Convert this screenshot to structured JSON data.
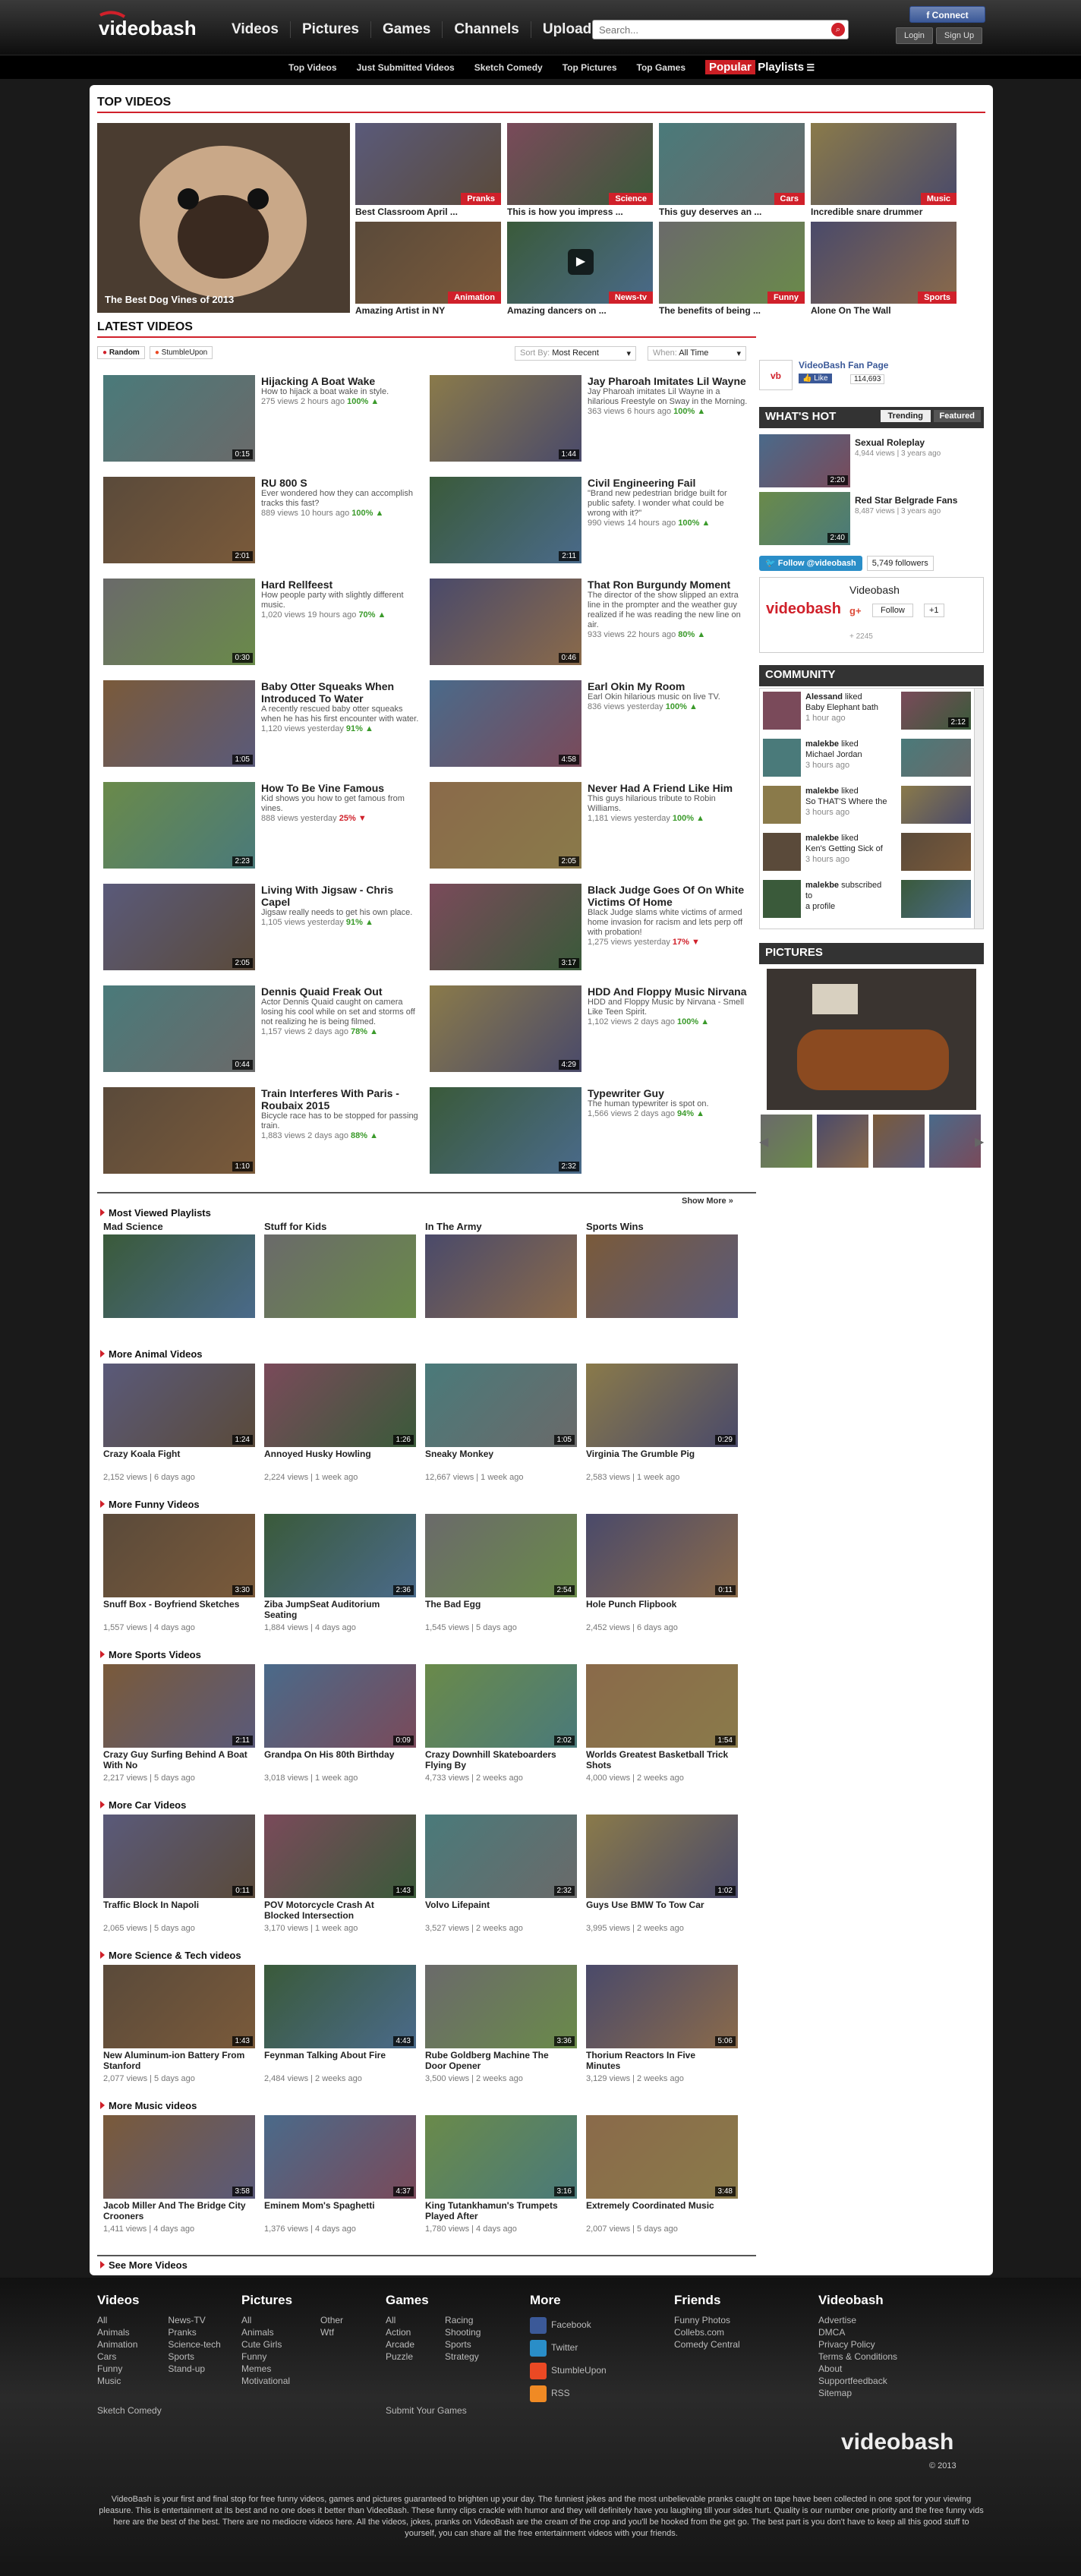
{
  "header": {
    "logo": "videobash",
    "nav": [
      "Videos",
      "Pictures",
      "Games",
      "Channels",
      "Upload"
    ],
    "search_placeholder": "Search...",
    "connect": "Connect",
    "login": "Login",
    "signup": "Sign Up"
  },
  "subnav": {
    "items": [
      "Top Videos",
      "Just Submitted Videos",
      "Sketch Comedy",
      "Top Pictures",
      "Top Games"
    ],
    "popular": "Popular",
    "playlists": "Playlists"
  },
  "top_videos": {
    "title": "TOP VIDEOS",
    "featured": "The Best Dog Vines of 2013",
    "items": [
      {
        "title": "Best Classroom April ...",
        "cat": "Pranks"
      },
      {
        "title": "This is how you impress ...",
        "cat": "Science"
      },
      {
        "title": "This guy deserves an ...",
        "cat": "Cars"
      },
      {
        "title": "Incredible snare drummer",
        "cat": "Music"
      },
      {
        "title": "Amazing Artist in NY",
        "cat": "Animation"
      },
      {
        "title": "Amazing dancers on ...",
        "cat": "News-tv"
      },
      {
        "title": "The benefits of being ...",
        "cat": "Funny"
      },
      {
        "title": "Alone On The Wall",
        "cat": "Sports"
      }
    ]
  },
  "latest": {
    "title": "LATEST VIDEOS",
    "random": "Random",
    "stumble": "StumbleUpon",
    "sort_label": "Sort By:",
    "sort_value": "Most Recent",
    "when_label": "When:",
    "when_value": "All Time",
    "show_more": "Show More »",
    "videos": [
      {
        "title": "Hijacking A Boat Wake",
        "desc": "How to hijack a boat wake in style.",
        "views": "275 views",
        "age": "2 hours ago",
        "pct": "100%",
        "dur": "0:15"
      },
      {
        "title": "Jay Pharoah Imitates Lil Wayne",
        "desc": "Jay Pharoah imitates Lil Wayne in a hilarious Freestyle on Sway in the Morning.",
        "views": "363 views",
        "age": "6 hours ago",
        "pct": "100%",
        "dur": "1:44"
      },
      {
        "title": "RU 800 S",
        "desc": "Ever wondered how they can accomplish tracks this fast?",
        "views": "889 views",
        "age": "10 hours ago",
        "pct": "100%",
        "dur": "2:01"
      },
      {
        "title": "Civil Engineering Fail",
        "desc": "\"Brand new pedestrian bridge built for public safety. I wonder what could be wrong with it?\"",
        "views": "990 views",
        "age": "14 hours ago",
        "pct": "100%",
        "dur": "2:11"
      },
      {
        "title": "Hard Rellfeest",
        "desc": "How people party with slightly different music.",
        "views": "1,020 views",
        "age": "19 hours ago",
        "pct": "70%",
        "dur": "0:30"
      },
      {
        "title": "That Ron Burgundy Moment",
        "desc": "The director of the show slipped an extra line in the prompter and the weather guy realized if he was reading the new line on air.",
        "views": "933 views",
        "age": "22 hours ago",
        "pct": "80%",
        "dur": "0:46"
      },
      {
        "title": "Baby Otter Squeaks When Introduced To Water",
        "desc": "A recently rescued baby otter squeaks when he has his first encounter with water.",
        "views": "1,120 views",
        "age": "yesterday",
        "pct": "91%",
        "dur": "1:05"
      },
      {
        "title": "Earl Okin My Room",
        "desc": "Earl Okin hilarious music on live TV.",
        "views": "836 views",
        "age": "yesterday",
        "pct": "100%",
        "dur": "4:58"
      },
      {
        "title": "How To Be Vine Famous",
        "desc": "Kid shows you how to get famous from vines.",
        "views": "888 views",
        "age": "yesterday",
        "pct": "25%",
        "neg": true,
        "dur": "2:23"
      },
      {
        "title": "Never Had A Friend Like Him",
        "desc": "This guys hilarious tribute to Robin Williams.",
        "views": "1,181 views",
        "age": "yesterday",
        "pct": "100%",
        "dur": "2:05"
      },
      {
        "title": "Living With Jigsaw - Chris Capel",
        "desc": "Jigsaw really needs to get his own place.",
        "views": "1,105 views",
        "age": "yesterday",
        "pct": "91%",
        "dur": "2:05"
      },
      {
        "title": "Black Judge Goes Of On White Victims Of Home",
        "desc": "Black Judge slams white victims of armed home invasion for racism and lets perp off with probation!",
        "views": "1,275 views",
        "age": "yesterday",
        "pct": "17%",
        "neg": true,
        "dur": "3:17"
      },
      {
        "title": "Dennis Quaid Freak Out",
        "desc": "Actor Dennis Quaid caught on camera losing his cool while on set and storms off not realizing he is being filmed.",
        "views": "1,157 views",
        "age": "2 days ago",
        "pct": "78%",
        "dur": "0:44"
      },
      {
        "title": "HDD And Floppy Music Nirvana",
        "desc": "HDD and Floppy Music by Nirvana - Smell Like Teen Spirit.",
        "views": "1,102 views",
        "age": "2 days ago",
        "pct": "100%",
        "dur": "4:29"
      },
      {
        "title": "Train Interferes With Paris - Roubaix 2015",
        "desc": "Bicycle race has to be stopped for passing train.",
        "views": "1,883 views",
        "age": "2 days ago",
        "pct": "88%",
        "dur": "1:10"
      },
      {
        "title": "Typewriter Guy",
        "desc": "The human typewriter is spot on.",
        "views": "1,566 views",
        "age": "2 days ago",
        "pct": "94%",
        "dur": "2:32"
      }
    ]
  },
  "playlists": {
    "title": "Most Viewed Playlists",
    "items": [
      "Mad Science",
      "Stuff for Kids",
      "In The Army",
      "Sports Wins"
    ]
  },
  "groups": [
    {
      "title": "More Animal Videos",
      "items": [
        {
          "t": "Crazy Koala Fight",
          "m": "2,152 views | 6 days ago",
          "d": "1:24"
        },
        {
          "t": "Annoyed Husky Howling",
          "m": "2,224 views | 1 week ago",
          "d": "1:26"
        },
        {
          "t": "Sneaky Monkey",
          "m": "12,667 views | 1 week ago",
          "d": "1:05"
        },
        {
          "t": "Virginia The Grumble Pig",
          "m": "2,583 views | 1 week ago",
          "d": "0:29"
        }
      ]
    },
    {
      "title": "More Funny Videos",
      "items": [
        {
          "t": "Snuff Box - Boyfriend Sketches",
          "m": "1,557 views | 4 days ago",
          "d": "3:30"
        },
        {
          "t": "Ziba JumpSeat Auditorium Seating",
          "m": "1,884 views | 4 days ago",
          "d": "2:36"
        },
        {
          "t": "The Bad Egg",
          "m": "1,545 views | 5 days ago",
          "d": "2:54"
        },
        {
          "t": "Hole Punch Flipbook",
          "m": "2,452 views | 6 days ago",
          "d": "0:11"
        }
      ]
    },
    {
      "title": "More Sports Videos",
      "items": [
        {
          "t": "Crazy Guy Surfing Behind A Boat With No",
          "m": "2,217 views | 5 days ago",
          "d": "2:11"
        },
        {
          "t": "Grandpa On His 80th Birthday",
          "m": "3,018 views | 1 week ago",
          "d": "0:09"
        },
        {
          "t": "Crazy Downhill Skateboarders Flying By",
          "m": "4,733 views | 2 weeks ago",
          "d": "2:02"
        },
        {
          "t": "Worlds Greatest Basketball Trick Shots",
          "m": "4,000 views | 2 weeks ago",
          "d": "1:54"
        }
      ]
    },
    {
      "title": "More Car Videos",
      "items": [
        {
          "t": "Traffic Block In Napoli",
          "m": "2,065 views | 5 days ago",
          "d": "0:11"
        },
        {
          "t": "POV Motorcycle Crash At Blocked Intersection",
          "m": "3,170 views | 1 week ago",
          "d": "1:43"
        },
        {
          "t": "Volvo Lifepaint",
          "m": "3,527 views | 2 weeks ago",
          "d": "2:32"
        },
        {
          "t": "Guys Use BMW To Tow Car",
          "m": "3,995 views | 2 weeks ago",
          "d": "1:02"
        }
      ]
    },
    {
      "title": "More Science & Tech videos",
      "items": [
        {
          "t": "New Aluminum-ion Battery From Stanford",
          "m": "2,077 views | 5 days ago",
          "d": "1:43"
        },
        {
          "t": "Feynman Talking About Fire",
          "m": "2,484 views | 2 weeks ago",
          "d": "4:43"
        },
        {
          "t": "Rube Goldberg Machine The Door Opener",
          "m": "3,500 views | 2 weeks ago",
          "d": "3:36"
        },
        {
          "t": "Thorium Reactors In Five Minutes",
          "m": "3,129 views | 2 weeks ago",
          "d": "5:06"
        }
      ]
    },
    {
      "title": "More Music videos",
      "items": [
        {
          "t": "Jacob Miller And The Bridge City Crooners",
          "m": "1,411 views | 4 days ago",
          "d": "3:58"
        },
        {
          "t": "Eminem Mom's Spaghetti",
          "m": "1,376 views | 4 days ago",
          "d": "4:37"
        },
        {
          "t": "King Tutankhamun's Trumpets Played After",
          "m": "1,780 views | 4 days ago",
          "d": "3:16"
        },
        {
          "t": "Extremely Coordinated Music",
          "m": "2,007 views | 5 days ago",
          "d": "3:48"
        }
      ]
    }
  ],
  "see_more": "See More Videos",
  "sidebar": {
    "fan_page": "VideoBash Fan Page",
    "like": "Like",
    "like_count": "114,693",
    "whats_hot": "WHAT'S HOT",
    "tab_trending": "Trending",
    "tab_featured": "Featured",
    "hot": [
      {
        "t": "Sexual Roleplay",
        "m": "4,944 views | 3 years ago",
        "d": "2:20"
      },
      {
        "t": "Red Star Belgrade Fans",
        "m": "8,487 views | 3 years ago",
        "d": "2:40"
      }
    ],
    "follow": "Follow @videobash",
    "followers": "5,749 followers",
    "gp_name": "Videobash",
    "gp_follow": "Follow",
    "gp_plus": "+1",
    "gp_count": "+ 2245",
    "community": "COMMUNITY",
    "comm": [
      {
        "u": "Alessand",
        "a": "liked",
        "t": "Baby Elephant bath",
        "m": "1 hour ago",
        "d": "2:12"
      },
      {
        "u": "malekbe",
        "a": "liked",
        "t": "Michael Jordan",
        "m": "3 hours ago"
      },
      {
        "u": "malekbe",
        "a": "liked",
        "t": "So THAT'S Where the",
        "m": "3 hours ago"
      },
      {
        "u": "malekbe",
        "a": "liked",
        "t": "Ken's Getting Sick of",
        "m": "3 hours ago"
      },
      {
        "u": "malekbe",
        "a": "subscribed to",
        "t": "a profile",
        "m": ""
      }
    ],
    "pictures": "PICTURES"
  },
  "footer": {
    "cols": [
      {
        "h": "Videos",
        "a": [
          "All",
          "Animals",
          "Animation",
          "Cars",
          "Funny",
          "Music"
        ],
        "b": [
          "News-TV",
          "Pranks",
          "Science-tech",
          "Sports",
          "Stand-up"
        ]
      },
      {
        "h": "Pictures",
        "a": [
          "All",
          "Animals",
          "Cute Girls",
          "Funny",
          "Memes",
          "Motivational"
        ],
        "b": [
          "Other",
          "Wtf"
        ]
      },
      {
        "h": "Games",
        "a": [
          "All",
          "Action",
          "Arcade",
          "Puzzle"
        ],
        "b": [
          "Racing",
          "Shooting",
          "Sports",
          "Strategy"
        ]
      },
      {
        "h": "More",
        "a": [
          "Facebook",
          "Twitter",
          "StumbleUpon",
          "RSS"
        ]
      },
      {
        "h": "Friends",
        "a": [
          "Funny Photos",
          "Collebs.com",
          "Comedy Central"
        ]
      },
      {
        "h": "Videobash",
        "a": [
          "Advertise",
          "DMCA",
          "Privacy Policy",
          "Terms & Conditions",
          "About",
          "Supportfeedback",
          "Sitemap"
        ]
      }
    ],
    "sketch": "Sketch Comedy",
    "submit": "Submit Your Games",
    "copyright": "© 2013",
    "text": "VideoBash is your first and final stop for free funny videos, games and pictures guaranteed to brighten up your day. The funniest jokes and the most unbelievable pranks caught on tape have been collected in one spot for your viewing pleasure. This is entertainment at its best and no one does it better than VideoBash. These funny clips crackle with humor and they will definitely have you laughing till your sides hurt. Quality is our number one priority and the free funny vids here are the best of the best. There are no mediocre videos here. All the videos, jokes, pranks on VideoBash are the cream of the crop and you'll be hooked from the get go. The best part is you don't have to keep all this good stuff to yourself, you can share all the free entertainment videos with your friends."
  },
  "colors": {
    "accent": "#d0202a",
    "brand_dark": "#1a1a1a",
    "fb": "#3b5998",
    "positive": "#3a9a2a"
  }
}
